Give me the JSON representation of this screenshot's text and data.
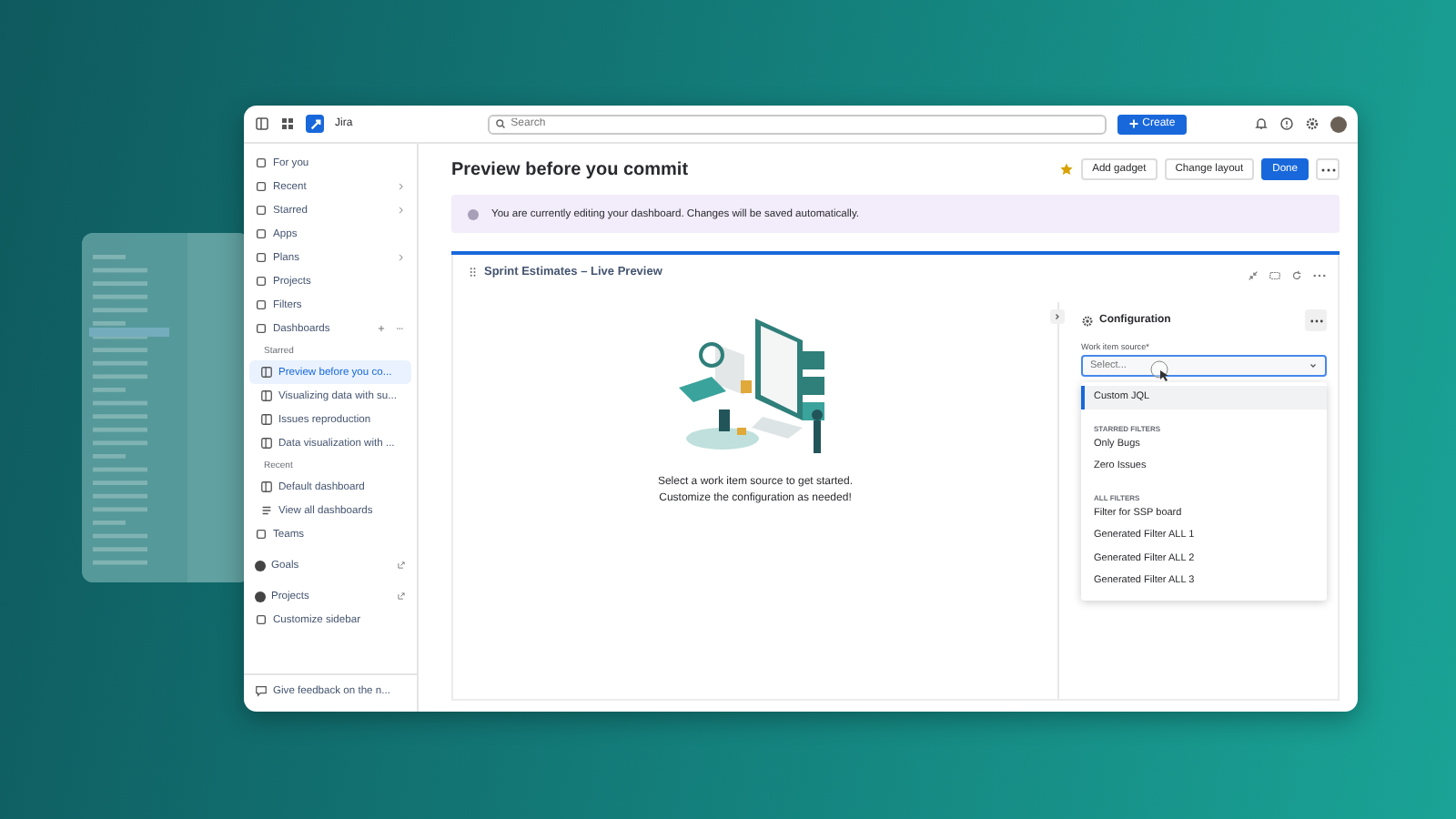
{
  "topbar": {
    "app_name": "Jira",
    "search": {
      "placeholder": "Search"
    },
    "create_button": "Create"
  },
  "sidebar": {
    "items": [
      {
        "kind": "nav",
        "label": "For you"
      },
      {
        "kind": "nav",
        "label": "Recent",
        "expandable": true
      },
      {
        "kind": "nav",
        "label": "Starred",
        "expandable": true
      },
      {
        "kind": "nav",
        "label": "Apps"
      },
      {
        "kind": "nav",
        "label": "Plans",
        "expandable": true
      },
      {
        "kind": "nav",
        "label": "Projects"
      },
      {
        "kind": "nav",
        "label": "Filters"
      },
      {
        "kind": "nav",
        "label": "Dashboards",
        "addable": true,
        "children": [
          {
            "kind": "header",
            "label": "Starred"
          },
          {
            "kind": "dashboard",
            "label": "Preview before you co...",
            "selected": true
          },
          {
            "kind": "dashboard",
            "label": "Visualizing data with su...",
            "selected": false
          },
          {
            "kind": "dashboard",
            "label": "Issues reproduction",
            "selected": false
          },
          {
            "kind": "dashboard",
            "label": "Data visualization with ...",
            "selected": false
          },
          {
            "kind": "header",
            "label": "Recent"
          },
          {
            "kind": "dashboard",
            "label": "Default dashboard",
            "selected": false
          },
          {
            "kind": "list",
            "label": "View all dashboards"
          }
        ]
      },
      {
        "kind": "nav",
        "label": "Teams"
      },
      {
        "kind": "app",
        "label": "Goals",
        "external": true
      },
      {
        "kind": "app",
        "label": "Projects",
        "external": true
      },
      {
        "kind": "nav",
        "label": "Customize sidebar"
      }
    ],
    "feedback": "Give feedback on the n..."
  },
  "page": {
    "title": "Preview before you commit",
    "buttons": [
      {
        "label": "Add gadget",
        "primary": false
      },
      {
        "label": "Change layout",
        "primary": false
      },
      {
        "label": "Done",
        "primary": true
      }
    ],
    "banner": "You are currently editing your dashboard. Changes will be saved automatically."
  },
  "gadget": {
    "title": "Sprint Estimates – Live Preview",
    "message": [
      "Select a work item source to get started.",
      "Customize the configuration as needed!"
    ],
    "config": {
      "title": "Configuration",
      "field_label": "Work item source*",
      "select": {
        "placeholder": "Select..."
      },
      "options": [
        {
          "kind": "option",
          "label": "Custom JQL",
          "selected": true
        },
        {
          "kind": "header",
          "label": "STARRED FILTERS"
        },
        {
          "kind": "option",
          "label": "Only Bugs",
          "selected": false
        },
        {
          "kind": "option",
          "label": "Zero Issues",
          "selected": false
        },
        {
          "kind": "header",
          "label": "ALL FILTERS"
        },
        {
          "kind": "option",
          "label": "Filter for SSP board",
          "selected": false
        },
        {
          "kind": "option",
          "label": "Generated Filter ALL 1",
          "selected": false
        },
        {
          "kind": "option",
          "label": "Generated Filter ALL 2",
          "selected": false
        },
        {
          "kind": "option",
          "label": "Generated Filter ALL 3",
          "selected": false
        }
      ]
    }
  }
}
